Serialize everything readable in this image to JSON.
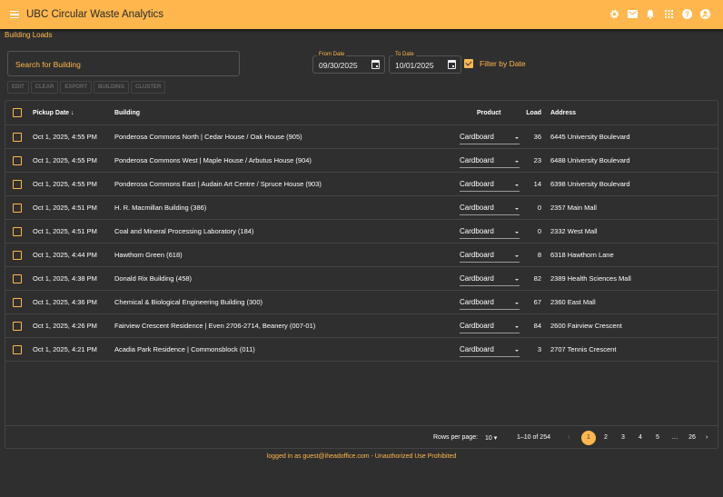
{
  "app": {
    "title": "UBC Circular Waste Analytics",
    "accent": "#ffb74d",
    "icons": [
      "gear-icon",
      "mail-icon",
      "bell-icon",
      "apps-icon",
      "help-icon",
      "account-icon"
    ]
  },
  "breadcrumb": "Building Loads",
  "search": {
    "placeholder": "Search for Building"
  },
  "from_date": {
    "label": "From Date",
    "value": "09/30/2025"
  },
  "to_date": {
    "label": "To Date",
    "value": "10/01/2025"
  },
  "filter": {
    "label": "Filter by Date",
    "checked": true
  },
  "toolbar": [
    "EDIT",
    "CLEAR",
    "EXPORT",
    "BUILDING",
    "CLUSTER"
  ],
  "table": {
    "headers": {
      "date": "Pickup Date",
      "building": "Building",
      "product": "Product",
      "load": "Load",
      "address": "Address"
    },
    "rows": [
      {
        "date": "Oct 1, 2025, 4:55 PM",
        "building": "Ponderosa Commons North | Cedar House / Oak House (905)",
        "product": "Cardboard",
        "load": "36",
        "address": "6445 University Boulevard"
      },
      {
        "date": "Oct 1, 2025, 4:55 PM",
        "building": "Ponderosa Commons West | Maple House / Arbutus House (904)",
        "product": "Cardboard",
        "load": "23",
        "address": "6488 University Boulevard"
      },
      {
        "date": "Oct 1, 2025, 4:55 PM",
        "building": "Ponderosa Commons East | Audain Art Centre / Spruce House (903)",
        "product": "Cardboard",
        "load": "14",
        "address": "6398 University Boulevard"
      },
      {
        "date": "Oct 1, 2025, 4:51 PM",
        "building": "H. R. Macmillan Building (386)",
        "product": "Cardboard",
        "load": "0",
        "address": "2357 Main Mall"
      },
      {
        "date": "Oct 1, 2025, 4:51 PM",
        "building": "Coal and Mineral Processing Laboratory (184)",
        "product": "Cardboard",
        "load": "0",
        "address": "2332 West Mall"
      },
      {
        "date": "Oct 1, 2025, 4:44 PM",
        "building": "Hawthorn Green (618)",
        "product": "Cardboard",
        "load": "8",
        "address": "6318 Hawthorn Lane"
      },
      {
        "date": "Oct 1, 2025, 4:38 PM",
        "building": "Donald Rix Building (458)",
        "product": "Cardboard",
        "load": "82",
        "address": "2389 Health Sciences Mall"
      },
      {
        "date": "Oct 1, 2025, 4:36 PM",
        "building": "Chemical & Biological Engineering Building (300)",
        "product": "Cardboard",
        "load": "67",
        "address": "2360 East Mall"
      },
      {
        "date": "Oct 1, 2025, 4:26 PM",
        "building": "Fairview Crescent Residence | Even 2706-2714, Beanery (007-01)",
        "product": "Cardboard",
        "load": "84",
        "address": "2600 Fairview Crescent"
      },
      {
        "date": "Oct 1, 2025, 4:21 PM",
        "building": "Acadia Park Residence | Commonsblock (011)",
        "product": "Cardboard",
        "load": "3",
        "address": "2707 Tennis Crescent"
      }
    ]
  },
  "pagination": {
    "rows_label": "Rows per page:",
    "rows_value": "10",
    "range": "1–10 of 254",
    "pages": [
      "1",
      "2",
      "3",
      "4",
      "5",
      "…",
      "26"
    ],
    "current": "1"
  },
  "footer": "logged in as guest@iheadoffice.com - Unauthorized Use Prohibited"
}
